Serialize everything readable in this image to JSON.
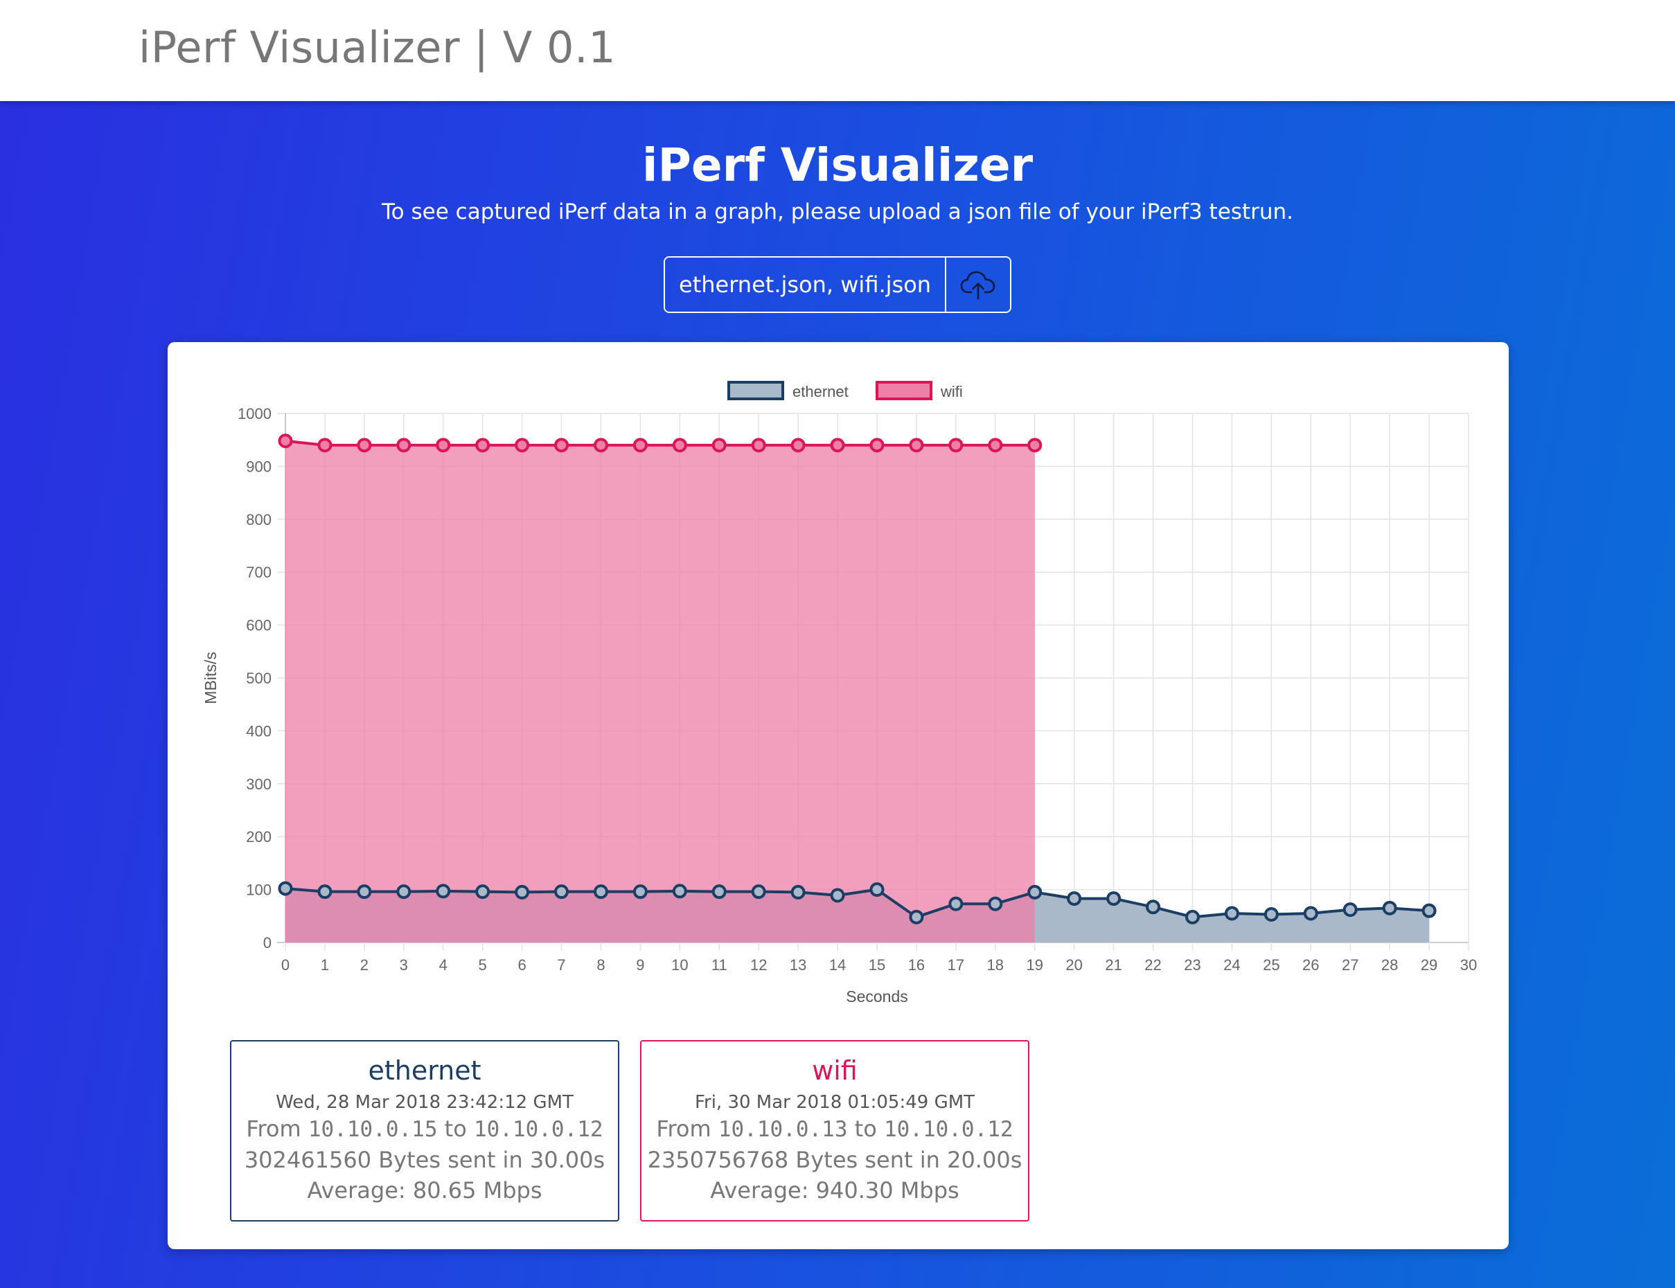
{
  "navbar": {
    "brand": "iPerf Visualizer | V 0.1"
  },
  "hero": {
    "title": "iPerf Visualizer",
    "subtitle": "To see captured iPerf data in a graph, please upload a json file of your iPerf3 testrun."
  },
  "upload": {
    "files": "ethernet.json, wifi.json",
    "icon": "cloud-upload-icon"
  },
  "chart_data": {
    "type": "line",
    "xlabel": "Seconds",
    "ylabel": "MBits/s",
    "ylim": [
      0,
      1000
    ],
    "xlim": [
      0,
      30
    ],
    "yticks": [
      "0",
      "100",
      "200",
      "300",
      "400",
      "500",
      "600",
      "700",
      "800",
      "900",
      "1000"
    ],
    "xticks": [
      "0",
      "1",
      "2",
      "3",
      "4",
      "5",
      "6",
      "7",
      "8",
      "9",
      "10",
      "11",
      "12",
      "13",
      "14",
      "15",
      "16",
      "17",
      "18",
      "19",
      "20",
      "21",
      "22",
      "23",
      "24",
      "25",
      "26",
      "27",
      "28",
      "29",
      "30"
    ],
    "grid": true,
    "legend_position": "top",
    "series": [
      {
        "name": "ethernet",
        "color": "#1b3e66",
        "fill": "#a9b9c9",
        "x": [
          0,
          1,
          2,
          3,
          4,
          5,
          6,
          7,
          8,
          9,
          10,
          11,
          12,
          13,
          14,
          15,
          16,
          17,
          18,
          19,
          20,
          21,
          22,
          23,
          24,
          25,
          26,
          27,
          28,
          29
        ],
        "values": [
          102,
          96,
          96,
          96,
          97,
          96,
          95,
          96,
          96,
          96,
          97,
          96,
          96,
          95,
          89,
          100,
          48,
          73,
          73,
          95,
          83,
          83,
          67,
          48,
          55,
          53,
          55,
          62,
          65,
          60
        ]
      },
      {
        "name": "wifi",
        "color": "#dc1558",
        "fill": "#ee7fa7",
        "x": [
          0,
          1,
          2,
          3,
          4,
          5,
          6,
          7,
          8,
          9,
          10,
          11,
          12,
          13,
          14,
          15,
          16,
          17,
          18,
          19
        ],
        "values": [
          948,
          940,
          940,
          940,
          940,
          940,
          940,
          940,
          940,
          940,
          940,
          940,
          940,
          940,
          940,
          940,
          940,
          940,
          940,
          940
        ]
      }
    ]
  },
  "summaries": [
    {
      "name": "ethernet",
      "color": "#1b3e66",
      "date": "Wed, 28 Mar 2018 23:42:12 GMT",
      "from_label": "From",
      "from_ip": "10.10.0.15",
      "to_label": "to",
      "to_ip": "10.10.0.12",
      "bytes": "302461560 Bytes sent in 30.00s",
      "average": "Average: 80.65 Mbps"
    },
    {
      "name": "wifi",
      "color": "#dc1558",
      "date": "Fri, 30 Mar 2018 01:05:49 GMT",
      "from_label": "From",
      "from_ip": "10.10.0.13",
      "to_label": "to",
      "to_ip": "10.10.0.12",
      "bytes": "2350756768 Bytes sent in 20.00s",
      "average": "Average: 940.30 Mbps"
    }
  ]
}
